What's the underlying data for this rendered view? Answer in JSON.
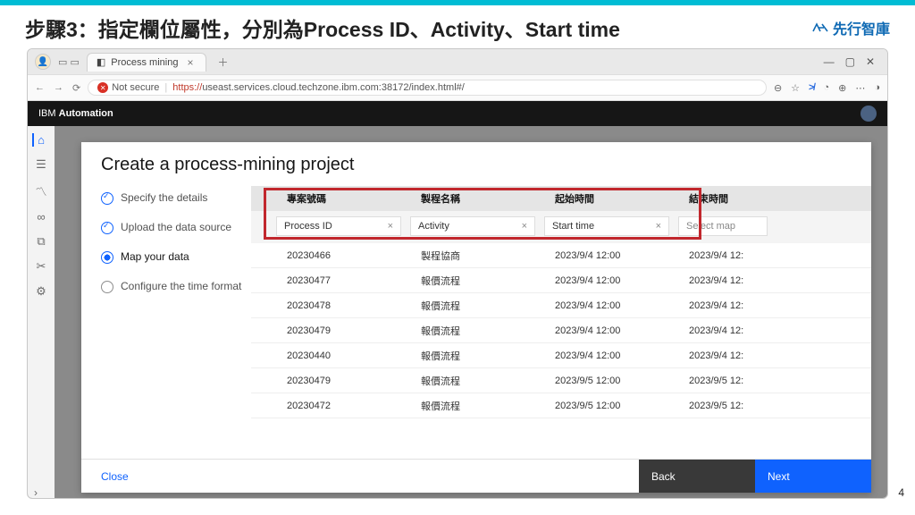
{
  "slide": {
    "title": "步驟3：指定欄位屬性，分別為Process ID、Activity、Start time",
    "brand": "先行智庫",
    "page_num": "4"
  },
  "browser": {
    "tab_title": "Process mining",
    "url_host": "useast.services.cloud.techzone.ibm.com",
    "url_port_path": ":38172/index.html#/",
    "not_secure": "Not secure",
    "https": "https://"
  },
  "ibm_bar": {
    "brand_prefix": "IBM ",
    "brand_bold": "Automation"
  },
  "modal": {
    "title": "Create a process-mining project",
    "steps": [
      "Specify the details",
      "Upload the data source",
      "Map your data",
      "Configure the time format"
    ],
    "columns": {
      "c1": "專案號碼",
      "c2": "製程名稱",
      "c3": "起始時間",
      "c4": "結束時間"
    },
    "selectors": {
      "s1": "Process ID",
      "s2": "Activity",
      "s3": "Start time",
      "s4": "Select map"
    },
    "rows": [
      {
        "id": "20230466",
        "act": "製程協商",
        "start": "2023/9/4 12:00",
        "end": "2023/9/4 12:"
      },
      {
        "id": "20230477",
        "act": "報價流程",
        "start": "2023/9/4 12:00",
        "end": "2023/9/4 12:"
      },
      {
        "id": "20230478",
        "act": "報價流程",
        "start": "2023/9/4 12:00",
        "end": "2023/9/4 12:"
      },
      {
        "id": "20230479",
        "act": "報價流程",
        "start": "2023/9/4 12:00",
        "end": "2023/9/4 12:"
      },
      {
        "id": "20230440",
        "act": "報價流程",
        "start": "2023/9/4 12:00",
        "end": "2023/9/4 12:"
      },
      {
        "id": "20230479",
        "act": "報價流程",
        "start": "2023/9/5 12:00",
        "end": "2023/9/5 12:"
      },
      {
        "id": "20230472",
        "act": "報價流程",
        "start": "2023/9/5 12:00",
        "end": "2023/9/5 12:"
      }
    ],
    "footer": {
      "close": "Close",
      "back": "Back",
      "next": "Next"
    }
  }
}
